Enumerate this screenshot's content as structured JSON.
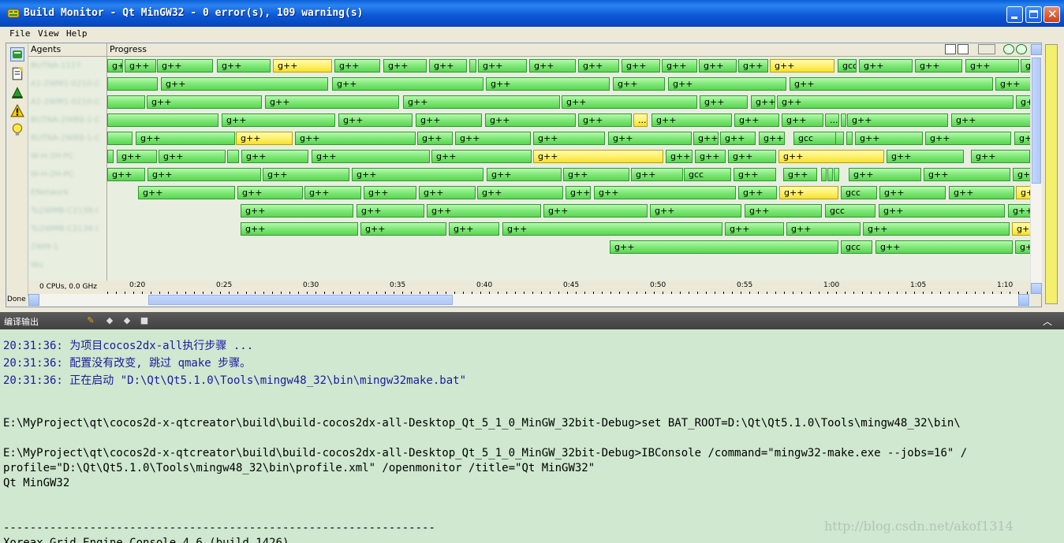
{
  "window": {
    "title": "Build Monitor - Qt MinGW32 - 0 error(s), 109 warning(s)"
  },
  "menu": [
    "File",
    "View",
    "Help"
  ],
  "headers": {
    "agents": "Agents",
    "progress": "Progress"
  },
  "cpu_label": "0 CPUs, 0.0 GHz",
  "status": "Done",
  "timeline_ticks": [
    "0:20",
    "0:25",
    "0:30",
    "0:35",
    "0:40",
    "0:45",
    "0:50",
    "0:55",
    "1:00",
    "1:05",
    "1:10"
  ],
  "agents": [
    "BUTNA-1127",
    "A1-2WM1-0210-C",
    "A1-2WM1-0210-C",
    "BUTNA-2WB8-1-C",
    "BUTNA-2WB8-1-C",
    "W-H-2H-PC",
    "W-H-2H-PC",
    "ENetwork",
    "Tu2WMB-C2138-(",
    "Tu2WMB-C2138-(",
    "2WM-1",
    "Wu"
  ],
  "jobs": [
    [
      [
        "g++",
        0,
        20,
        "n"
      ],
      [
        "g++",
        22,
        40,
        "n"
      ],
      [
        "g++",
        63,
        71,
        "n"
      ],
      [
        "g++",
        139,
        68,
        "n"
      ],
      [
        "g++",
        210,
        75,
        "w"
      ],
      [
        "g++",
        288,
        58,
        "n"
      ],
      [
        "g++",
        350,
        55,
        "n"
      ],
      [
        "g++",
        408,
        48,
        "n"
      ],
      [
        "",
        459,
        9,
        "n"
      ],
      [
        "g++",
        470,
        62,
        "n"
      ],
      [
        "g++",
        535,
        59,
        "n"
      ],
      [
        "g++",
        597,
        52,
        "n"
      ],
      [
        "g++",
        652,
        49,
        "n"
      ],
      [
        "g++",
        703,
        45,
        "n"
      ],
      [
        "g++",
        750,
        48,
        "n"
      ],
      [
        "g++",
        800,
        38,
        "n"
      ],
      [
        "g++",
        840,
        82,
        "w"
      ],
      [
        "gcc",
        926,
        24,
        "n"
      ],
      [
        "g++",
        953,
        68,
        "n"
      ],
      [
        "g++",
        1024,
        60,
        "n"
      ],
      [
        "g++",
        1088,
        68,
        "n"
      ],
      [
        "g++",
        1158,
        30,
        "n"
      ]
    ],
    [
      [
        "",
        0,
        64,
        "n"
      ],
      [
        "g++",
        68,
        212,
        "n"
      ],
      [
        "g++",
        285,
        192,
        "n"
      ],
      [
        "g++",
        480,
        157,
        "n"
      ],
      [
        "g++",
        641,
        66,
        "n"
      ],
      [
        "g++",
        711,
        150,
        "n"
      ],
      [
        "g++",
        865,
        258,
        "n"
      ],
      [
        "g++",
        1126,
        60,
        "n"
      ]
    ],
    [
      [
        "",
        0,
        48,
        "n"
      ],
      [
        "g++",
        50,
        146,
        "n"
      ],
      [
        "g++",
        200,
        170,
        "n"
      ],
      [
        "g++",
        375,
        199,
        "n"
      ],
      [
        "g++",
        576,
        172,
        "n"
      ],
      [
        "g++",
        751,
        61,
        "n"
      ],
      [
        "g++",
        816,
        31,
        "n"
      ],
      [
        "g++",
        849,
        300,
        "n"
      ],
      [
        "g++",
        1152,
        40,
        "n"
      ]
    ],
    [
      [
        "",
        0,
        141,
        "n"
      ],
      [
        "g++",
        145,
        144,
        "n"
      ],
      [
        "g++",
        293,
        94,
        "n"
      ],
      [
        "g++",
        391,
        84,
        "n"
      ],
      [
        "g++",
        479,
        115,
        "n"
      ],
      [
        "g++",
        597,
        68,
        "n"
      ],
      [
        "...",
        667,
        18,
        "w"
      ],
      [
        "g++",
        690,
        102,
        "n"
      ],
      [
        "g++",
        795,
        57,
        "n"
      ],
      [
        "g++",
        855,
        53,
        "n"
      ],
      [
        "...",
        910,
        18,
        "n"
      ],
      [
        "",
        930,
        5,
        "n"
      ],
      [
        "g++",
        938,
        128,
        "n"
      ],
      [
        "g++",
        1070,
        110,
        "n"
      ]
    ],
    [
      [
        "",
        0,
        32,
        "n"
      ],
      [
        "g++",
        36,
        126,
        "n"
      ],
      [
        "g++",
        163,
        72,
        "w"
      ],
      [
        "g++",
        238,
        153,
        "n"
      ],
      [
        "g++",
        393,
        45,
        "n"
      ],
      [
        "g++",
        441,
        96,
        "n"
      ],
      [
        "g++",
        540,
        91,
        "n"
      ],
      [
        "g++",
        635,
        106,
        "n"
      ],
      [
        "g++",
        743,
        32,
        "n"
      ],
      [
        "g++",
        777,
        45,
        "n"
      ],
      [
        "g++",
        826,
        33,
        "n"
      ],
      [
        "gcc",
        870,
        54,
        "n"
      ],
      [
        "",
        923,
        11,
        "n"
      ],
      [
        "",
        937,
        8,
        "n"
      ],
      [
        "g++",
        948,
        86,
        "n"
      ],
      [
        "g++",
        1037,
        109,
        "n"
      ],
      [
        "g++",
        1150,
        40,
        "n"
      ]
    ],
    [
      [
        "",
        0,
        8,
        "n"
      ],
      [
        "g++",
        12,
        51,
        "n"
      ],
      [
        "g++",
        65,
        85,
        "n"
      ],
      [
        "",
        152,
        15,
        "n"
      ],
      [
        "g++",
        170,
        85,
        "n"
      ],
      [
        "g++",
        259,
        150,
        "n"
      ],
      [
        "g++",
        411,
        127,
        "n"
      ],
      [
        "g++",
        540,
        165,
        "w"
      ],
      [
        "g++",
        708,
        34,
        "n"
      ],
      [
        "g++",
        745,
        39,
        "n"
      ],
      [
        "g++",
        787,
        61,
        "n"
      ],
      [
        "g++",
        851,
        134,
        "w"
      ],
      [
        "g++",
        988,
        98,
        "n"
      ],
      [
        "g++",
        1095,
        75,
        "n"
      ]
    ],
    [
      [
        "g++",
        0,
        48,
        "n"
      ],
      [
        "g++",
        51,
        144,
        "n"
      ],
      [
        "g++",
        197,
        110,
        "n"
      ],
      [
        "g++",
        310,
        167,
        "n"
      ],
      [
        "g++",
        481,
        95,
        "n"
      ],
      [
        "g++",
        578,
        84,
        "n"
      ],
      [
        "g++",
        664,
        66,
        "n"
      ],
      [
        "gcc",
        731,
        60,
        "n"
      ],
      [
        "g++",
        794,
        54,
        "n"
      ],
      [
        "g++",
        857,
        43,
        "n"
      ],
      [
        "",
        905,
        5,
        "n"
      ],
      [
        "",
        913,
        5,
        "n"
      ],
      [
        "",
        921,
        5,
        "n"
      ],
      [
        "g++",
        940,
        92,
        "n"
      ],
      [
        "g++",
        1035,
        110,
        "n"
      ],
      [
        "g++",
        1148,
        44,
        "n"
      ]
    ],
    [
      [
        "g++",
        39,
        123,
        "n"
      ],
      [
        "g++",
        165,
        83,
        "n"
      ],
      [
        "g++",
        250,
        72,
        "n"
      ],
      [
        "g++",
        325,
        67,
        "n"
      ],
      [
        "g++",
        395,
        72,
        "n"
      ],
      [
        "g++",
        469,
        109,
        "n"
      ],
      [
        "g++",
        581,
        32,
        "n"
      ],
      [
        "g++",
        617,
        180,
        "n"
      ],
      [
        "g++",
        800,
        49,
        "n"
      ],
      [
        "g++",
        852,
        75,
        "w"
      ],
      [
        "gcc",
        930,
        46,
        "n"
      ],
      [
        "g++",
        979,
        84,
        "n"
      ],
      [
        "g++",
        1067,
        83,
        "n"
      ],
      [
        "g++",
        1152,
        40,
        "w"
      ]
    ],
    [
      [
        "g++",
        169,
        143,
        "n"
      ],
      [
        "g++",
        316,
        86,
        "n"
      ],
      [
        "g++",
        405,
        145,
        "n"
      ],
      [
        "g++",
        553,
        132,
        "n"
      ],
      [
        "g++",
        688,
        116,
        "n"
      ],
      [
        "g++",
        808,
        98,
        "n"
      ],
      [
        "gcc",
        910,
        64,
        "n"
      ],
      [
        "g++",
        978,
        160,
        "n"
      ],
      [
        "g++",
        1142,
        50,
        "n"
      ]
    ],
    [
      [
        "g++",
        169,
        149,
        "n"
      ],
      [
        "g++",
        321,
        109,
        "n"
      ],
      [
        "g++",
        433,
        64,
        "n"
      ],
      [
        "g++",
        501,
        279,
        "n"
      ],
      [
        "g++",
        783,
        75,
        "n"
      ],
      [
        "g++",
        861,
        94,
        "n"
      ],
      [
        "g++",
        958,
        186,
        "n"
      ],
      [
        "g++",
        1147,
        40,
        "w"
      ]
    ],
    [
      [
        "g++",
        637,
        290,
        "n"
      ],
      [
        "gcc",
        930,
        40,
        "n"
      ],
      [
        "g++",
        974,
        174,
        "n"
      ],
      [
        "g++",
        1151,
        40,
        "n"
      ]
    ],
    []
  ],
  "output": {
    "title": "编译输出",
    "lines": [
      {
        "text": "20:31:36: 为项目cocos2dx-all执行步骤 ...",
        "color": "blue"
      },
      {
        "text": "20:31:36: 配置没有改变, 跳过 qmake 步骤。",
        "color": "blue"
      },
      {
        "text": "20:31:36: 正在启动 \"D:\\Qt\\Qt5.1.0\\Tools\\mingw48_32\\bin\\mingw32make.bat\"",
        "color": "blue"
      },
      {
        "text": "E:\\MyProject\\qt\\cocos2d-x-qtcreator\\build\\build-cocos2dx-all-Desktop_Qt_5_1_0_MinGW_32bit-Debug>set BAT_ROOT=D:\\Qt\\Qt5.1.0\\Tools\\mingw48_32\\bin\\",
        "color": "black"
      },
      {
        "text": "E:\\MyProject\\qt\\cocos2d-x-qtcreator\\build\\build-cocos2dx-all-Desktop_Qt_5_1_0_MinGW_32bit-Debug>IBConsole /command=\"mingw32-make.exe --jobs=16\" /",
        "color": "black"
      },
      {
        "text": "profile=\"D:\\Qt\\Qt5.1.0\\Tools\\mingw48_32\\bin\\profile.xml\" /openmonitor /title=\"Qt MinGW32\"",
        "color": "black"
      },
      {
        "text": "Qt MinGW32",
        "color": "black"
      },
      {
        "text": "-----------------------------------------------------------------",
        "color": "black"
      },
      {
        "text": "Xoreax Grid Engine Console 4.6 (build 1426)",
        "color": "black"
      }
    ],
    "watermark": "http://blog.csdn.net/akof1314"
  }
}
